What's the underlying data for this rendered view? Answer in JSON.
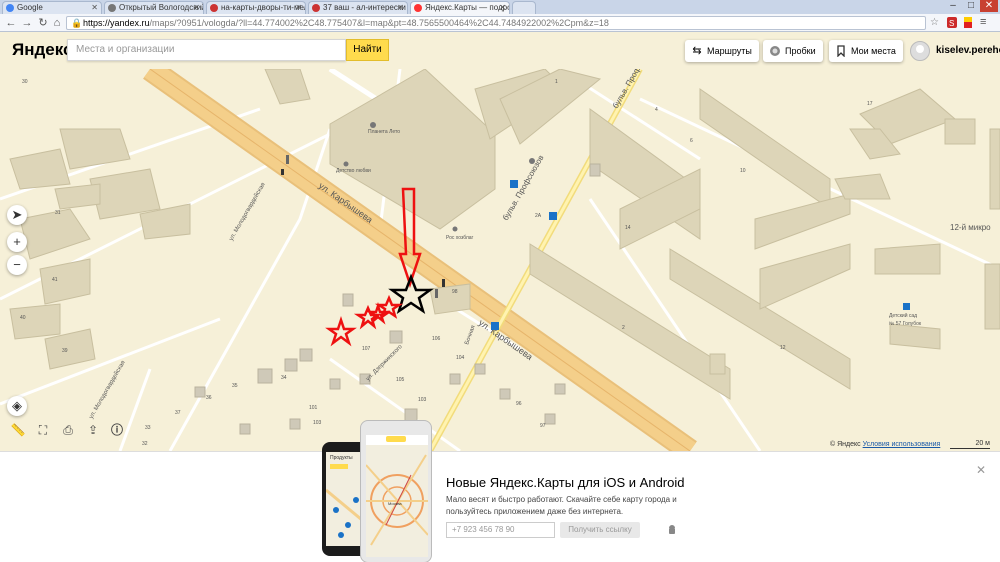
{
  "browser": {
    "tabs": [
      {
        "label": "Google",
        "color": "#4285f4"
      },
      {
        "label": "Открытый Вологодский - С…",
        "color": "#777777"
      },
      {
        "label": "на-карты-дворы-ти-мелен…",
        "color": "#cc3333"
      },
      {
        "label": "37 ваш - ал-интерески …",
        "color": "#cc3333"
      },
      {
        "label": "Яндекс.Карты — подроб…",
        "color": "#ff3333"
      }
    ],
    "window_controls": [
      "–",
      "□",
      "✕"
    ],
    "url_host": "https://yandex.ru",
    "url_path": "/maps/?0951/vologda/?ll=44.774002%2C48.775407&l=map&pt=48.7565500464%2C44.7484922002%2Cpm&z=18"
  },
  "header": {
    "logo": "Яндекс",
    "search_placeholder": "Места и организации",
    "find_label": "Найти",
    "routes_label": "Маршруты",
    "traffic_label": "Пробки",
    "myplaces_label": "Мои места",
    "username": "kiselev.perehod"
  },
  "map": {
    "streets": {
      "karbysheva_upper": "ул. Карбышева",
      "karbysheva_lower": "ул. Карбышева",
      "prospekt": "бульв. Профсоюзов",
      "prospekt2": "бульв. Профсоюзов",
      "molodezhnaya": "ул. Молодогвардейская",
      "dzerzhinskogo": "ул. Дзержинского",
      "molodezhnaya2": "ул. Молодогвардейская",
      "bochnaya": "Бочная"
    },
    "pois": {
      "planeta_leto": "Планета Лето",
      "detstvo": "Детство любви",
      "ros_hozblag": "Рос хозблаг",
      "kindergarten_1": "Детский сад",
      "kindergarten_2": "№ 57 Голубок",
      "district": "12-й микро"
    },
    "house_numbers": [
      "107",
      "106",
      "104",
      "105",
      "103",
      "101",
      "103",
      "34",
      "35",
      "36",
      "37",
      "33",
      "32",
      "31",
      "30",
      "29",
      "28",
      "27",
      "2А",
      "2",
      "1",
      "2",
      "4",
      "6",
      "10",
      "12",
      "14",
      "16",
      "17",
      "41",
      "40",
      "39",
      "38",
      "100",
      "98",
      "97",
      "96",
      "129"
    ],
    "copyright": "© Яндекс",
    "license_link": "Условия использования",
    "scale": "20 м"
  },
  "promo": {
    "title": "Новые Яндекс.Карты для iOS и Android",
    "desc": "Мало весят и быстро работают. Скачайте себе карту города и пользуйтесь приложением даже без интернета.",
    "phone_placeholder": "+7 923 456 78 90",
    "getlink_label": "Получить ссылку",
    "phone_screen_title": "Продукты",
    "phone_screen_city": "Москва"
  }
}
